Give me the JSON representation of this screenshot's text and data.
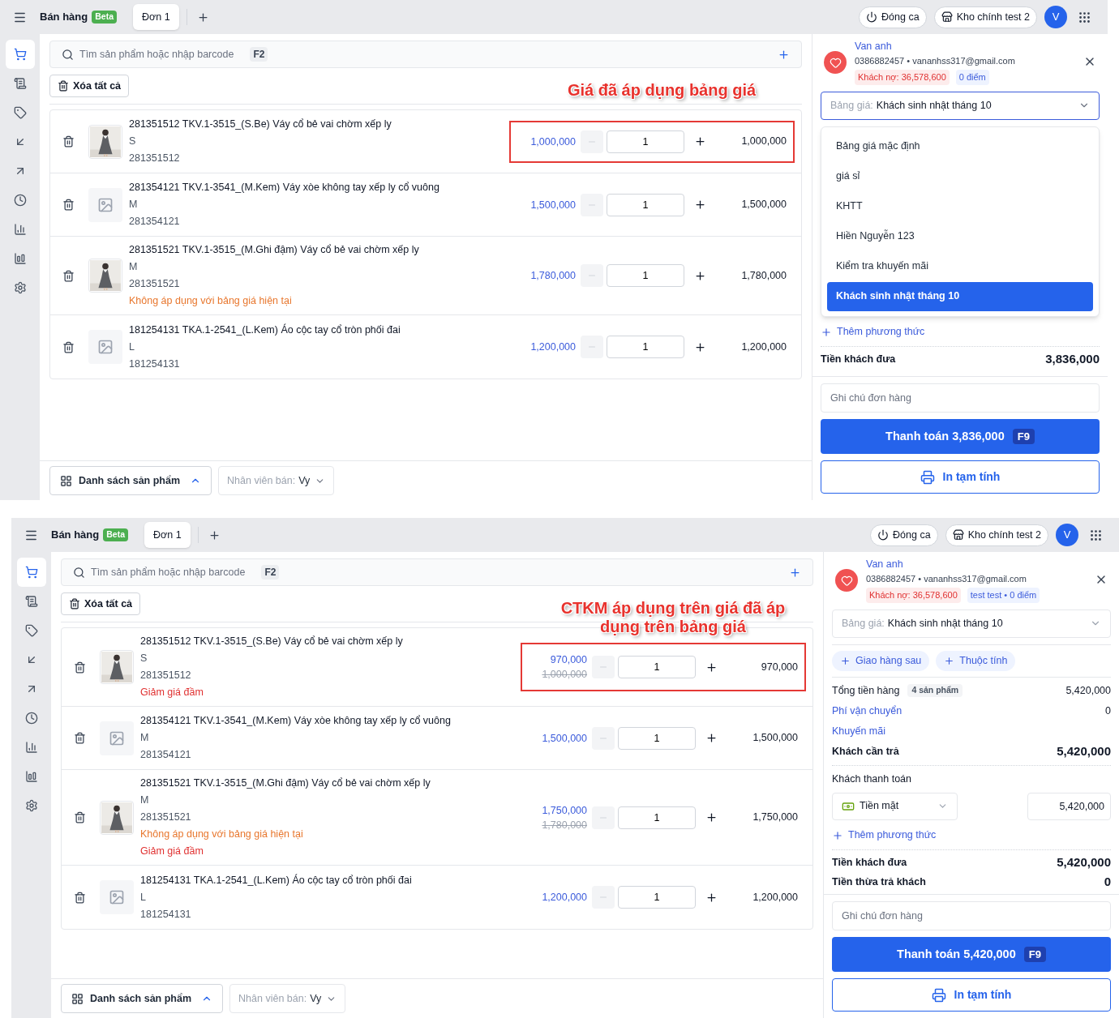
{
  "screens": [
    {
      "app_title": "Bán hàng",
      "badge": "Beta",
      "tabs": [
        {
          "label": "Đơn 1",
          "selected": true
        }
      ],
      "actions": [
        "Đóng ca",
        "Kho chính test 2"
      ],
      "avatar": "V",
      "sidebar": [
        {
          "selected": true
        },
        {
          "selected": false
        },
        {
          "selected": false
        },
        {
          "selected": false
        },
        {
          "selected": false
        },
        {
          "selected": false
        },
        {
          "selected": false
        },
        {
          "selected": false
        },
        {
          "selected": false
        }
      ],
      "search": {
        "placeholder": "Tìm sản phẩm hoặc nhập barcode",
        "shortcut": "F2"
      },
      "clear_all": "Xóa tất cả",
      "annotation": "Giá đã áp dụng bảng giá",
      "products": [
        {
          "name": "281351512 TKV.1-3515_(S.Be) Váy cổ bẻ vai chờm xếp ly",
          "variant": "S",
          "sku": "281351512",
          "has_image": true,
          "price": "1,000,000",
          "quantity": "1",
          "total": "1,000,000",
          "highlighted": true
        },
        {
          "name": "281354121 TKV.1-3541_(M.Kem) Váy xòe không tay xếp ly cổ vuông",
          "variant": "M",
          "sku": "281354121",
          "has_image": false,
          "price": "1,500,000",
          "quantity": "1",
          "total": "1,500,000",
          "highlighted": false
        },
        {
          "name": "281351521 TKV.1-3515_(M.Ghi đậm) Váy cổ bẻ vai chờm xếp ly",
          "variant": "M",
          "sku": "281351521",
          "has_image": true,
          "notes": [
            {
              "kind": "warning",
              "text": "Không áp dụng với bảng giá hiện tại"
            }
          ],
          "price": "1,780,000",
          "quantity": "1",
          "total": "1,780,000",
          "highlighted": false
        },
        {
          "name": "181254131 TKA.1-2541_(L.Kem) Áo cộc tay cổ tròn phối đai",
          "variant": "L",
          "sku": "181254131",
          "has_image": false,
          "price": "1,200,000",
          "quantity": "1",
          "total": "1,200,000",
          "highlighted": false
        }
      ],
      "footer": {
        "product_list": "Danh sách sản phẩm",
        "seller_label": "Nhân viên bán:",
        "seller": "Vy"
      },
      "customer": {
        "name": "Van anh",
        "contact": "0386882457 • vananhss317@gmail.com",
        "debt": "Khách nợ: 36,578,600",
        "points": "0 điểm"
      },
      "price_list": {
        "label": "Bảng giá:",
        "value": "Khách sinh nhật tháng 10",
        "open": true,
        "options": [
          {
            "label": "Bảng giá mặc định",
            "selected": false
          },
          {
            "label": "giá sỉ",
            "selected": false
          },
          {
            "label": "KHTT",
            "selected": false
          },
          {
            "label": "Hiền Nguyễn 123",
            "selected": false
          },
          {
            "label": "Kiểm tra khuyến mãi",
            "selected": false
          },
          {
            "label": "Khách sinh nhật tháng 10",
            "selected": true
          }
        ]
      },
      "add_method": "Thêm phương thức",
      "totals": [
        {
          "label": "Tiền khách đưa",
          "value": "3,836,000"
        }
      ],
      "note_placeholder": "Ghi chú đơn hàng",
      "pay_button": "Thanh toán 3,836,000",
      "pay_shortcut": "F9",
      "print_button": "In tạm tính"
    },
    {
      "app_title": "Bán hàng",
      "badge": "Beta",
      "tabs": [
        {
          "label": "Đơn 1",
          "selected": true
        }
      ],
      "actions": [
        "Đóng ca",
        "Kho chính test 2"
      ],
      "avatar": "V",
      "sidebar": [
        {
          "selected": true
        },
        {
          "selected": false
        },
        {
          "selected": false
        },
        {
          "selected": false
        },
        {
          "selected": false
        },
        {
          "selected": false
        },
        {
          "selected": false
        },
        {
          "selected": false
        },
        {
          "selected": false
        }
      ],
      "search": {
        "placeholder": "Tìm sản phẩm hoặc nhập barcode",
        "shortcut": "F2"
      },
      "clear_all": "Xóa tất cả",
      "annotation": "CTKM áp dụng trên giá đã áp dụng trên bảng giá",
      "products": [
        {
          "name": "281351512 TKV.1-3515_(S.Be) Váy cổ bẻ vai chờm xếp ly",
          "variant": "S",
          "sku": "281351512",
          "has_image": true,
          "notes": [
            {
              "kind": "promo",
              "text": "Giảm giá đầm"
            }
          ],
          "price": "970,000",
          "old_price": "1,000,000",
          "quantity": "1",
          "total": "970,000",
          "highlighted": true
        },
        {
          "name": "281354121 TKV.1-3541_(M.Kem) Váy xòe không tay xếp ly cổ vuông",
          "variant": "M",
          "sku": "281354121",
          "has_image": false,
          "price": "1,500,000",
          "quantity": "1",
          "total": "1,500,000",
          "highlighted": false
        },
        {
          "name": "281351521 TKV.1-3515_(M.Ghi đậm) Váy cổ bẻ vai chờm xếp ly",
          "variant": "M",
          "sku": "281351521",
          "has_image": true,
          "notes": [
            {
              "kind": "warning",
              "text": "Không áp dụng với bảng giá hiện tại"
            },
            {
              "kind": "promo",
              "text": "Giảm giá đầm"
            }
          ],
          "price": "1,750,000",
          "old_price": "1,780,000",
          "quantity": "1",
          "total": "1,750,000",
          "highlighted": false
        },
        {
          "name": "181254131 TKA.1-2541_(L.Kem) Áo cộc tay cổ tròn phối đai",
          "variant": "L",
          "sku": "181254131",
          "has_image": false,
          "price": "1,200,000",
          "quantity": "1",
          "total": "1,200,000",
          "highlighted": false
        }
      ],
      "footer": {
        "product_list": "Danh sách sản phẩm",
        "seller_label": "Nhân viên bán:",
        "seller": "Vy"
      },
      "customer": {
        "name": "Van anh",
        "contact": "0386882457 • vananhss317@gmail.com",
        "debt": "Khách nợ: 36,578,600",
        "points": "test test • 0 điểm"
      },
      "price_list": {
        "label": "Bảng giá:",
        "value": "Khách sinh nhật tháng 10",
        "open": false
      },
      "extras": [
        "Giao hàng sau",
        "Thuộc tính"
      ],
      "summary": [
        {
          "kind": "plain",
          "label": "Tổng tiền hàng",
          "tag": "4 sản phẩm",
          "value": "5,420,000"
        },
        {
          "kind": "link",
          "label": "Phí vận chuyển",
          "value": "0"
        },
        {
          "kind": "link",
          "label": "Khuyến mãi"
        },
        {
          "kind": "strong",
          "label": "Khách cần trả",
          "value": "5,420,000"
        }
      ],
      "payment": {
        "label": "Khách thanh toán",
        "method": "Tiền mặt",
        "amount": "5,420,000"
      },
      "add_method": "Thêm phương thức",
      "totals": [
        {
          "label": "Tiền khách đưa",
          "value": "5,420,000"
        },
        {
          "label": "Tiền thừa trả khách",
          "value": "0"
        }
      ],
      "note_placeholder": "Ghi chú đơn hàng",
      "pay_button": "Thanh toán 5,420,000",
      "pay_shortcut": "F9",
      "print_button": "In tạm tính"
    }
  ]
}
